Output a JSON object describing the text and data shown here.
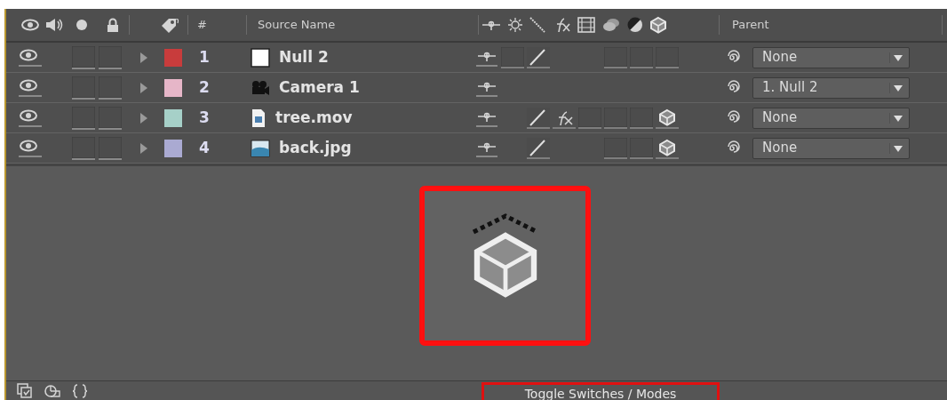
{
  "header": {
    "number_label": "#",
    "source_label": "Source Name",
    "parent_label": "Parent"
  },
  "layers": [
    {
      "number": "1",
      "color": "#c83c3c",
      "visible": true,
      "source": {
        "kind": "solid"
      },
      "name": "Null 2",
      "switches": [
        {
          "kind": "anchor"
        },
        {
          "kind": "empty"
        },
        {
          "kind": "quality"
        },
        {
          "kind": "blank"
        },
        {
          "kind": "blank"
        },
        {
          "kind": "empty"
        },
        {
          "kind": "empty"
        },
        {
          "kind": "empty"
        }
      ],
      "parent": "None"
    },
    {
      "number": "2",
      "color": "#e6b6c8",
      "visible": true,
      "source": {
        "kind": "camera"
      },
      "name": "Camera 1",
      "switches": [
        {
          "kind": "anchor"
        },
        {
          "kind": "blank"
        },
        {
          "kind": "blank"
        },
        {
          "kind": "blank"
        },
        {
          "kind": "blank"
        },
        {
          "kind": "blank"
        },
        {
          "kind": "blank"
        },
        {
          "kind": "blank"
        }
      ],
      "parent": "1. Null 2"
    },
    {
      "number": "3",
      "color": "#a6d0c8",
      "visible": true,
      "source": {
        "kind": "movie"
      },
      "name": "tree.mov",
      "switches": [
        {
          "kind": "anchor"
        },
        {
          "kind": "blank"
        },
        {
          "kind": "quality"
        },
        {
          "kind": "fx"
        },
        {
          "kind": "empty"
        },
        {
          "kind": "empty"
        },
        {
          "kind": "empty"
        },
        {
          "kind": "cube"
        }
      ],
      "parent": "None"
    },
    {
      "number": "4",
      "color": "#aaaad2",
      "visible": true,
      "source": {
        "kind": "image"
      },
      "name": "back.jpg",
      "switches": [
        {
          "kind": "anchor"
        },
        {
          "kind": "blank"
        },
        {
          "kind": "quality"
        },
        {
          "kind": "blank"
        },
        {
          "kind": "blank"
        },
        {
          "kind": "empty"
        },
        {
          "kind": "empty"
        },
        {
          "kind": "cube"
        }
      ],
      "parent": "None"
    }
  ],
  "footer": {
    "toggle_label": "Toggle Switches / Modes"
  }
}
